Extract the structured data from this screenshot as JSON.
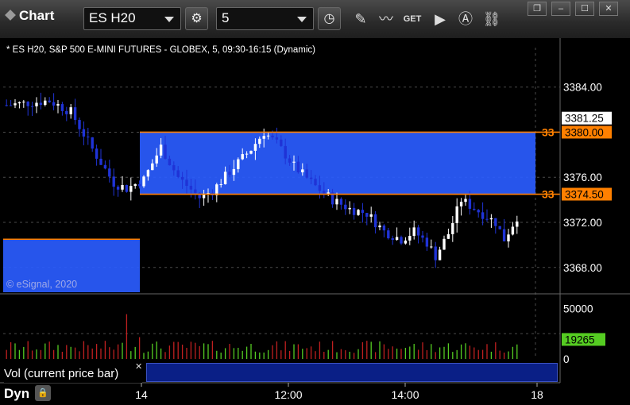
{
  "toolbar": {
    "chart_label": "Chart",
    "symbol_value": "ES H20",
    "interval_value": "5",
    "icons": [
      "chart-pin-icon",
      "chart-settings-icon",
      "clock-icon",
      "pencil-icon",
      "studies-icon",
      "get-icon",
      "play-icon",
      "alert-icon",
      "link-icon"
    ],
    "get_label": "GET"
  },
  "window_controls": [
    "restore-icon",
    "minimize-icon",
    "maximize-icon",
    "close-icon"
  ],
  "chart_data": {
    "type": "candlestick",
    "header": "* ES H20, S&P 500 E-MINI FUTURES - GLOBEX, 5, 09:30-16:15 (Dynamic)",
    "copyright": "© eSignal, 2020",
    "price_ticks": [
      "3384.00",
      "3376.00",
      "3372.00",
      "3368.00"
    ],
    "price_tick_values": [
      3384,
      3376,
      3372,
      3368
    ],
    "ylim": [
      3365.8,
      3387.5
    ],
    "time_ticks": [
      "14",
      "12:00",
      "14:00",
      "18"
    ],
    "bars_count": 120,
    "current_price": "3381.25",
    "current_price_value": 3381.25,
    "levels": [
      {
        "label": "3380.00",
        "tag": "33",
        "value": 3380.0,
        "color": "#ff8000"
      },
      {
        "label": "3374.50",
        "tag": "33",
        "value": 3374.5,
        "color": "#ff8000"
      }
    ],
    "zones": [
      {
        "value_top": 3380.0,
        "value_bottom": 3374.5,
        "color": "#2a5cff"
      },
      {
        "value_top": 3370.5,
        "value_bottom": null,
        "color": "#2a5cff"
      }
    ],
    "close_path": [
      [
        0,
        3382.4
      ],
      [
        10,
        3382.8
      ],
      [
        15,
        3381.8
      ],
      [
        20,
        3378.5
      ],
      [
        25,
        3375.5
      ],
      [
        28,
        3375.0
      ],
      [
        32,
        3375.8
      ],
      [
        36,
        3378.7
      ],
      [
        40,
        3376.0
      ],
      [
        45,
        3374.2
      ],
      [
        48,
        3374.8
      ],
      [
        52,
        3376.5
      ],
      [
        57,
        3378.5
      ],
      [
        60,
        3380.0
      ],
      [
        63,
        3379.0
      ],
      [
        67,
        3377.0
      ],
      [
        72,
        3375.2
      ],
      [
        76,
        3374.0
      ],
      [
        80,
        3373.2
      ],
      [
        84,
        3372.8
      ],
      [
        88,
        3371.2
      ],
      [
        92,
        3370.5
      ],
      [
        95,
        3371.2
      ],
      [
        98,
        3370.2
      ],
      [
        100,
        3369.0
      ],
      [
        103,
        3371.0
      ],
      [
        106,
        3374.0
      ],
      [
        110,
        3373.0
      ],
      [
        114,
        3372.0
      ],
      [
        116,
        3370.5
      ],
      [
        119,
        3372.5
      ],
      [
        121,
        3376.0
      ],
      [
        124,
        3379.5
      ],
      [
        126,
        3381.0
      ]
    ],
    "volume": {
      "label": "Vol (current price bar)",
      "ticks": [
        "50000",
        "0"
      ],
      "tick_values": [
        50000,
        0
      ],
      "ylim": [
        0,
        62000
      ],
      "current": "19265",
      "current_value": 19265
    },
    "colors": {
      "up": "#ffffff",
      "down": "#1f33d6",
      "vol_up": "#55cc22",
      "vol_down": "#c02020",
      "level": "#ff8000",
      "zone": "#2a5cff",
      "grid": "#4a4a4a",
      "current_price_bg": "#ffffff"
    }
  },
  "study": {
    "dyn_label": "Dyn",
    "close_icon": "✕"
  }
}
